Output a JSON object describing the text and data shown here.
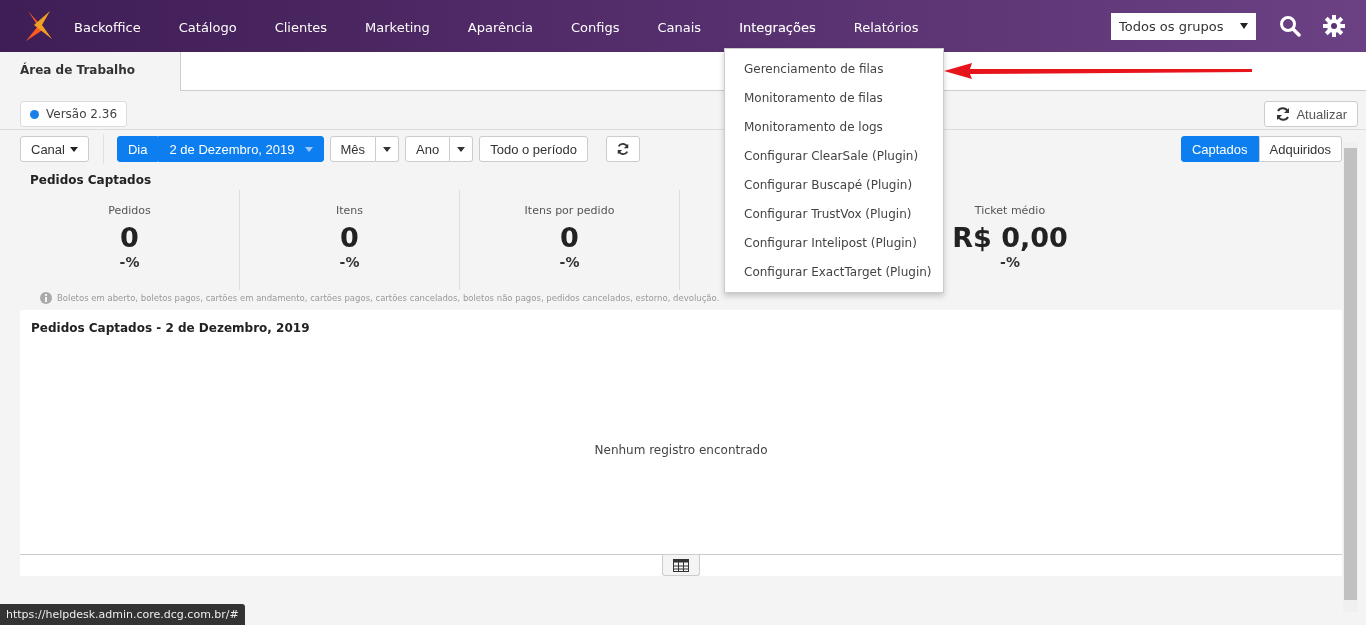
{
  "nav": {
    "items": [
      {
        "label": "Backoffice",
        "selected": false
      },
      {
        "label": "Catálogo",
        "selected": false
      },
      {
        "label": "Clientes",
        "selected": false
      },
      {
        "label": "Marketing",
        "selected": false
      },
      {
        "label": "Aparência",
        "selected": false
      },
      {
        "label": "Configs",
        "selected": false
      },
      {
        "label": "Canais",
        "selected": false
      },
      {
        "label": "Integrações",
        "selected": true
      },
      {
        "label": "Relatórios",
        "selected": false
      }
    ],
    "group_select": "Todos os grupos"
  },
  "tabs": [
    {
      "label": "Área de Trabalho",
      "selected": true
    }
  ],
  "version": "Versão 2.36",
  "refresh_button": "Atualizar",
  "filters": {
    "channel": "Canal",
    "periods": [
      {
        "label": "Dia",
        "selected": true,
        "value": "2 de Dezembro, 2019"
      },
      {
        "label": "Mês",
        "selected": false
      },
      {
        "label": "Ano",
        "selected": false
      },
      {
        "label": "Todo o período",
        "selected": false
      }
    ]
  },
  "modes": [
    {
      "label": "Captados",
      "selected": true
    },
    {
      "label": "Adquiridos",
      "selected": false
    }
  ],
  "summary": {
    "title": "Pedidos Captados",
    "stats": [
      {
        "label": "Pedidos",
        "value": "0",
        "change": "-%"
      },
      {
        "label": "Itens",
        "value": "0",
        "change": "-%"
      },
      {
        "label": "Itens por pedido",
        "value": "0",
        "change": "-%"
      },
      {
        "label": "Ticket médio",
        "value": "R$ 0,00",
        "change": "-%"
      }
    ],
    "note": "Boletos em aberto, boletos pagos, cartões em andamento, cartões pagos, cartões cancelados, boletos não pagos, pedidos cancelados, estorno, devolução."
  },
  "detail": {
    "title": "Pedidos Captados - 2 de Dezembro, 2019",
    "empty": "Nenhum registro encontrado"
  },
  "dropdown": {
    "items": [
      "Gerenciamento de filas",
      "Monitoramento de filas",
      "Monitoramento de logs",
      "Configurar ClearSale (Plugin)",
      "Configurar Buscapé (Plugin)",
      "Configurar TrustVox (Plugin)",
      "Configurar Intelipost (Plugin)",
      "Configurar ExactTarget (Plugin)"
    ]
  },
  "status_url": "https://helpdesk.admin.core.dcg.com.br/#"
}
